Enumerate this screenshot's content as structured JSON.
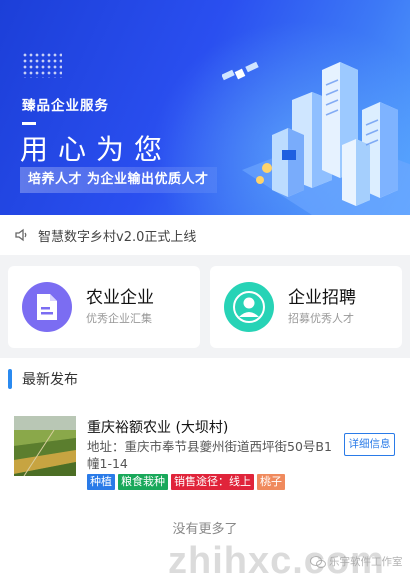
{
  "banner": {
    "subtitle": "臻品企业服务",
    "headline": "用心为您",
    "slogan": "培养人才 为企业输出优质人才"
  },
  "notice": {
    "text": "智慧数字乡村v2.0正式上线"
  },
  "cards": [
    {
      "title": "农业企业",
      "subtitle": "优秀企业汇集",
      "icon": "document-icon",
      "color": "#7b6df2"
    },
    {
      "title": "企业招聘",
      "subtitle": "招募优秀人才",
      "icon": "person-icon",
      "color": "#27d3b6"
    }
  ],
  "section": {
    "title": "最新发布"
  },
  "listing": {
    "title": "重庆裕额农业 (大坝村)",
    "address": "地址：重庆市奉节县夔州街道西坪街50号B1幢1-14",
    "detail_label": "详细信息",
    "tags": [
      {
        "text": "种植",
        "color": "#2a7be8"
      },
      {
        "text": "粮食栽种",
        "color": "#19a85a"
      },
      {
        "text": "销售途径：线上",
        "color": "#e0243a"
      },
      {
        "text": "桃子",
        "color": "#f08a5d"
      }
    ]
  },
  "footer": {
    "no_more": "没有更多了"
  },
  "watermark": {
    "site": "zhihxc.com",
    "account": "乐宇软件工作室"
  }
}
